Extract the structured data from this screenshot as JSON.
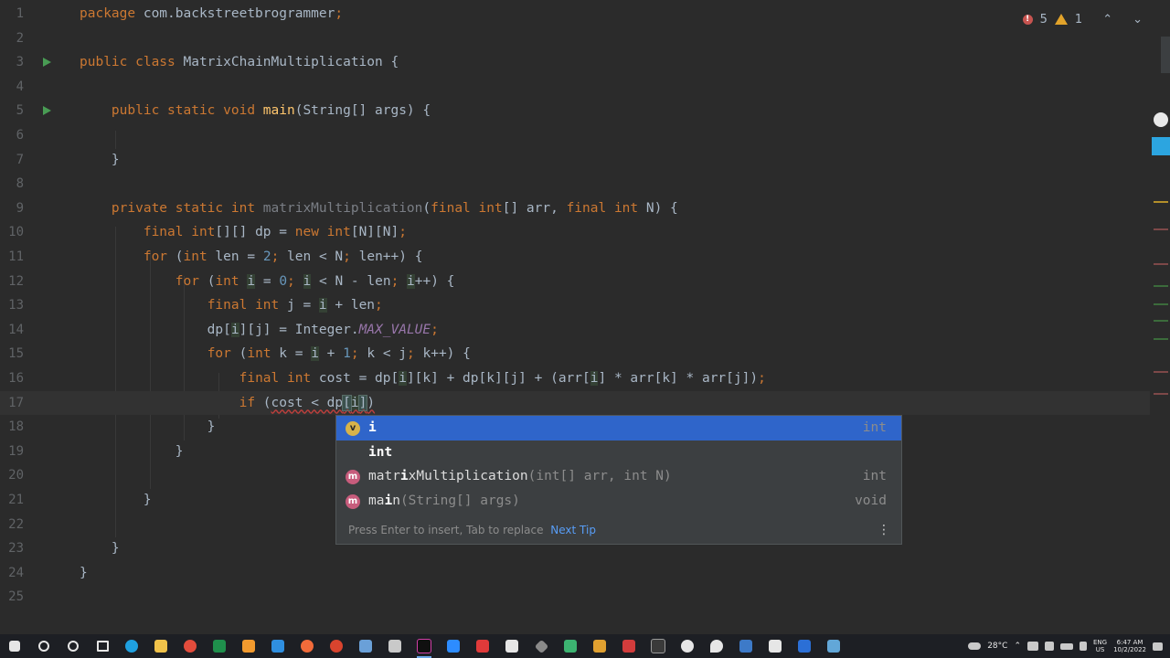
{
  "editor": {
    "line_numbers": [
      "1",
      "2",
      "3",
      "4",
      "5",
      "6",
      "7",
      "8",
      "9",
      "10",
      "11",
      "12",
      "13",
      "14",
      "15",
      "16",
      "17",
      "18",
      "19",
      "20",
      "21",
      "22",
      "23",
      "24",
      "25"
    ],
    "current_line": "17"
  },
  "inspections": {
    "errors": "5",
    "warnings": "1"
  },
  "completion": {
    "items": [
      {
        "name_match": "i",
        "name_rest": "",
        "tail": "",
        "type": "int",
        "icon": "variable-icon",
        "icon_letter": "v"
      },
      {
        "name_match": "i",
        "name_rest": "nt",
        "tail": "",
        "type": "",
        "icon": "keyword",
        "icon_letter": ""
      },
      {
        "name_pre": "matr",
        "name_match": "i",
        "name_rest": "xMultiplication",
        "tail": "(int[] arr, int N)",
        "type": "int",
        "icon": "method-icon",
        "icon_letter": "m"
      },
      {
        "name_pre": "ma",
        "name_match": "i",
        "name_rest": "n",
        "tail": "(String[] args)",
        "type": "void",
        "icon": "method-icon",
        "icon_letter": "m"
      }
    ],
    "hint_text": "Press Enter to insert, Tab to replace",
    "hint_link": "Next Tip"
  },
  "taskbar": {
    "temperature": "28°C",
    "language_top": "ENG",
    "language_bottom": "US",
    "time": "6:47 AM",
    "date": "10/2/2022"
  },
  "colors": {
    "background": "#2b2b2b",
    "keyword": "#cc7832",
    "method": "#ffc66d",
    "number": "#6897bb",
    "selection": "#2f65ca"
  }
}
